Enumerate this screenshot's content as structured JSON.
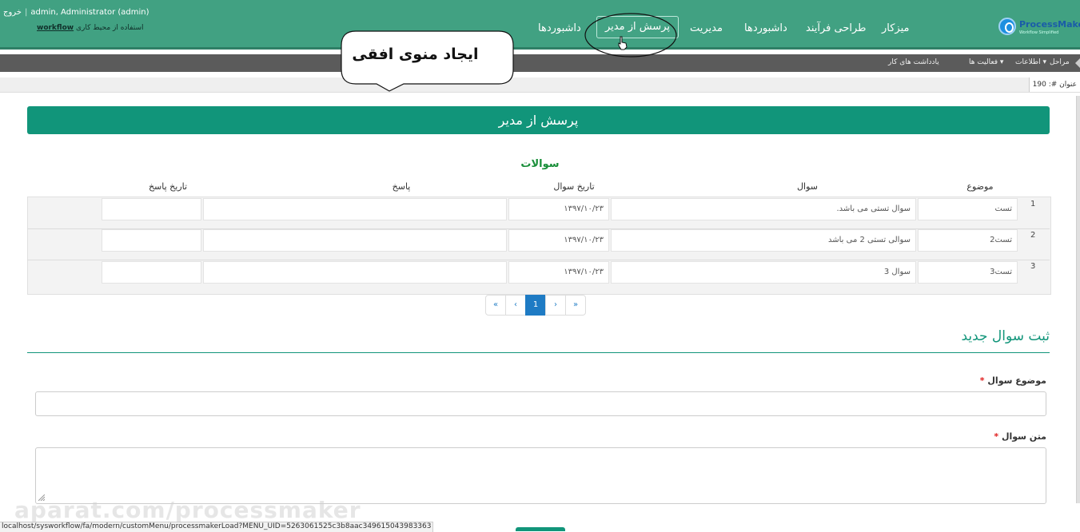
{
  "header": {
    "logout": "خروج",
    "user": "admin, Administrator (admin)",
    "workspace_prefix": "استفاده از محیط کاری",
    "workspace": "workflow",
    "logo_text": "ProcessMaker",
    "logo_tagline": "Workflow Simplified",
    "nav": {
      "home": "میزکار",
      "designer": "طراحی فرآیند",
      "dashboards": "داشبوردها",
      "admin": "مدیریت",
      "ask": "پرسش از مدیر",
      "dashboards2": "داشبوردها"
    }
  },
  "toolbar": {
    "steps": "مراحل",
    "info": "اطلاعات",
    "actions": "فعالیت ها",
    "notes": "یادداشت های کار"
  },
  "title_bar": {
    "label": "عنوان #: 190"
  },
  "annotation": {
    "text": "ایجاد منوی افقی"
  },
  "form": {
    "header": "پرسش از مدیر",
    "grid_title": "سوالات",
    "columns": {
      "subject": "موضوع",
      "question": "سوال",
      "question_date": "تاریخ سوال",
      "answer": "پاسخ",
      "answer_date": "تاریخ پاسخ"
    },
    "rows": [
      {
        "num": "1",
        "subject": "تست",
        "question": "سوال تستی می باشد.",
        "question_date": "۱۳۹۷/۱۰/۲۳",
        "answer": "",
        "answer_date": ""
      },
      {
        "num": "2",
        "subject": "تست2",
        "question": "سوالی تستی 2 می باشد",
        "question_date": "۱۳۹۷/۱۰/۲۳",
        "answer": "",
        "answer_date": ""
      },
      {
        "num": "3",
        "subject": "تست3",
        "question": "سوال 3",
        "question_date": "۱۳۹۷/۱۰/۲۳",
        "answer": "",
        "answer_date": ""
      }
    ],
    "pager": {
      "first": "«",
      "prev": "‹",
      "current": "1",
      "next": "›",
      "last": "»"
    },
    "new_section": "ثبت سوال جدید",
    "subject_label": "موضوع سوال",
    "text_label": "متن سوال",
    "required_mark": "*"
  },
  "watermark": "aparat.com/processmaker",
  "status_url": "localhost/sysworkflow/fa/modern/customMenu/processmakerLoad?MENU_UID=5263061525c3b8aac349615043983363",
  "colors": {
    "brand": "#41a182",
    "header_bar": "#11957a",
    "pager_active": "#1e7bc4",
    "required": "#e02020"
  }
}
